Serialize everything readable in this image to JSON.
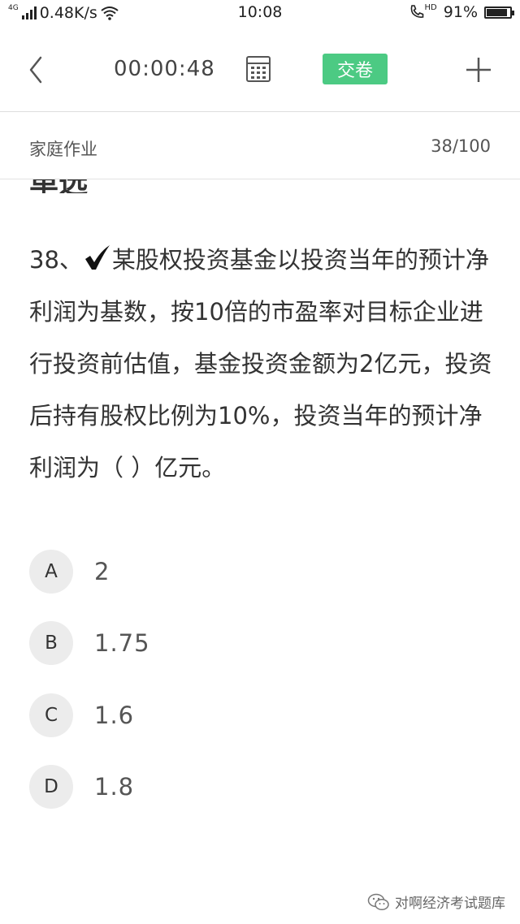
{
  "status_bar": {
    "network_type": "4G",
    "speed": "0.48K/s",
    "time": "10:08",
    "hd": "HD",
    "battery_percent": "91%",
    "battery_level": 0.91
  },
  "header": {
    "timer": "00:00:48",
    "submit_label": "交卷",
    "accent_color": "#4cca83"
  },
  "sub_header": {
    "section_name": "家庭作业",
    "progress": "38/100"
  },
  "cut_heading": "单选",
  "question": {
    "number": "38、",
    "text": "某股权投资基金以投资当年的预计净利润为基数，按10倍的市盈率对目标企业进行投资前估值，基金投资金额为2亿元，投资后持有股权比例为10%，投资当年的预计净利润为（ ）亿元。"
  },
  "options": [
    {
      "letter": "A",
      "text": "2"
    },
    {
      "letter": "B",
      "text": "1.75"
    },
    {
      "letter": "C",
      "text": "1.6"
    },
    {
      "letter": "D",
      "text": "1.8"
    }
  ],
  "watermark": {
    "text": "对啊经济考试题库",
    "icon": "wechat-icon"
  }
}
